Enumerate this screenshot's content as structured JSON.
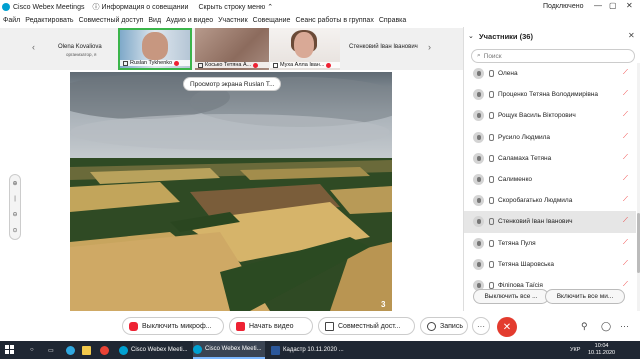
{
  "app": {
    "title": "Cisco Webex Meetings",
    "info_label": "Информация о совещании",
    "hide_menu_label": "Скрыть строку меню",
    "status": "Подключено"
  },
  "menu": [
    "Файл",
    "Редактировать",
    "Совместный доступ",
    "Вид",
    "Аудио и видео",
    "Участник",
    "Совещание",
    "Сеанс работы в группах",
    "Справка"
  ],
  "thumbnails": {
    "t1_name": "Olena Kovaliova",
    "t1_role": "организатор, я",
    "t2_name": "Ruslan Tykhenko",
    "t3_name": "Косько Тетяна А...",
    "t4_name": "Муха Алла Іван...",
    "t5_name": "Стенковий Іван Іванович"
  },
  "share": {
    "banner": "Просмотр экрана Ruslan T...",
    "page_number": "3"
  },
  "participants": {
    "title": "Участники (36)",
    "search_placeholder": "Поиск",
    "list": [
      "Олена",
      "Проценко Тетяна Володимирівна",
      "Рощук Василь Вікторович",
      "Русило Людмила",
      "Саламаха Тетяна",
      "Салименко",
      "Скоробагатько Людмила",
      "Стенковий Іван Іванович",
      "Тетяна Пуля",
      "Тетяна Шаровська",
      "Філіпова Таїсія"
    ],
    "mute_all": "Выключить все ...",
    "unmute_all": "Включить все ми..."
  },
  "controls": {
    "mute": "Выключить микроф...",
    "video": "Начать видео",
    "share": "Совместный дост...",
    "record": "Запись",
    "more": "···"
  },
  "taskbar": {
    "items": [
      "Cisco Webex Meeti...",
      "Cisco Webex Meeti...",
      "Кадастр 10.11.2020 ..."
    ],
    "lang": "УКР",
    "time": "10:04",
    "date": "10.11.2020"
  }
}
